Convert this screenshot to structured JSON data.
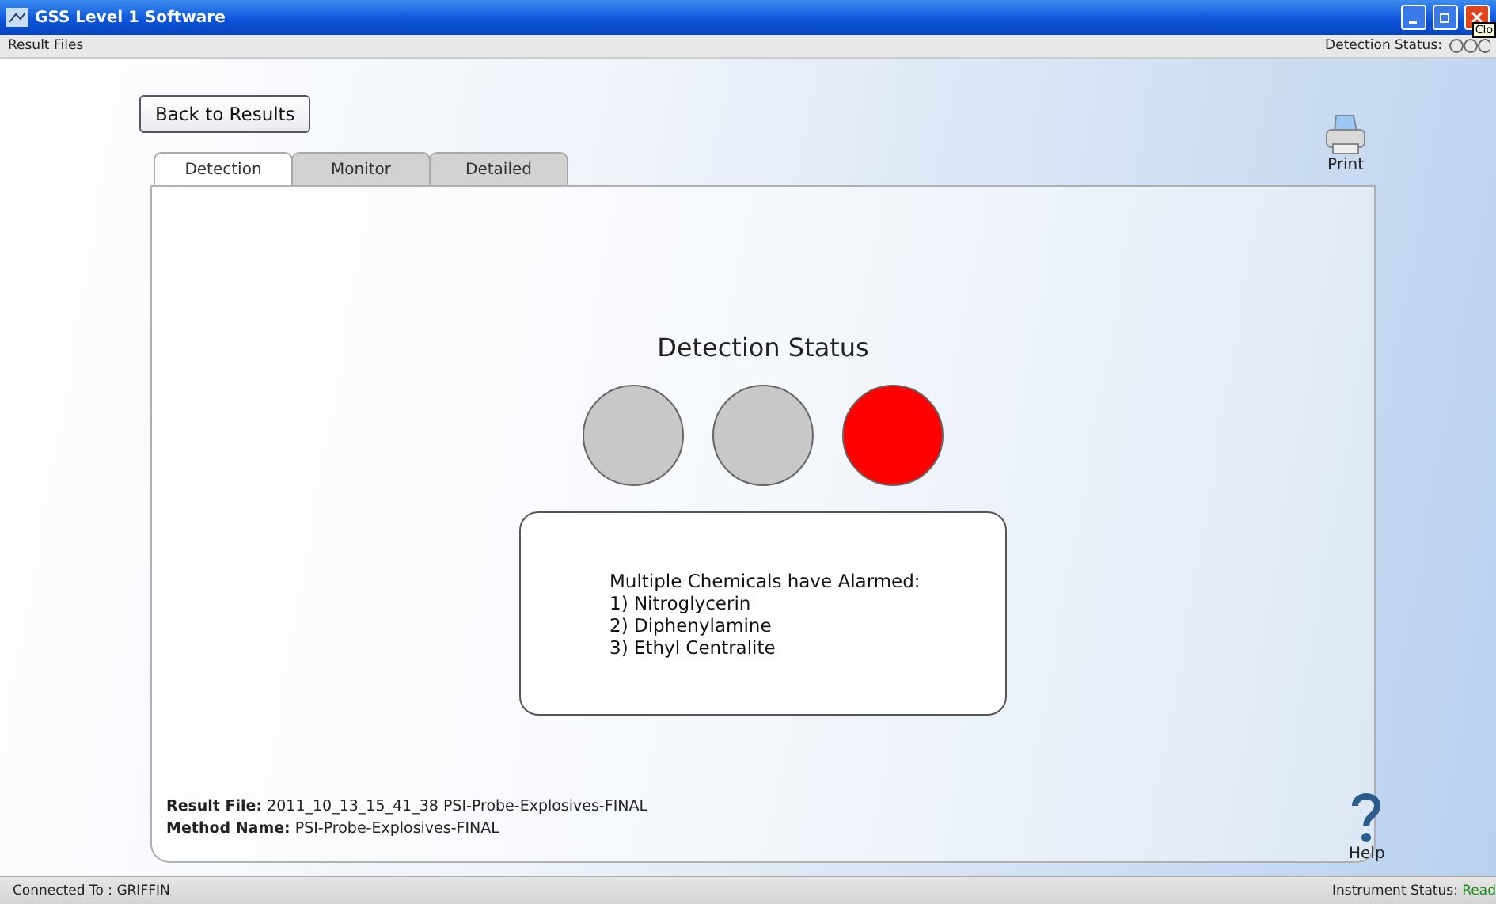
{
  "window": {
    "title": "GSS Level 1 Software",
    "tooltip": "Clo"
  },
  "menu_bar": {
    "left": "Result Files",
    "detection_status_label": "Detection Status:"
  },
  "back_button": "Back to Results",
  "print_label": "Print",
  "tabs": [
    {
      "label": "Detection",
      "selected": true
    },
    {
      "label": "Monitor",
      "selected": false
    },
    {
      "label": "Detailed",
      "selected": false
    }
  ],
  "detection": {
    "title": "Detection Status",
    "lights": [
      {
        "color": "#c8c8c8"
      },
      {
        "color": "#c8c8c8"
      },
      {
        "color": "#ff0000"
      }
    ],
    "message": {
      "heading": "Multiple Chemicals have Alarmed:",
      "items": [
        "1) Nitroglycerin",
        "2) Diphenylamine",
        "3) Ethyl Centralite"
      ]
    }
  },
  "result_info": [
    {
      "label": "Result File:",
      "value": "2011_10_13_15_41_38 PSI-Probe-Explosives-FINAL"
    },
    {
      "label": "Method Name:",
      "value": "PSI-Probe-Explosives-FINAL"
    }
  ],
  "help_label": "Help",
  "status_bar": {
    "connected": "Connected To : GRIFFIN",
    "instrument_label": "Instrument Status:",
    "instrument_value": "Read"
  }
}
